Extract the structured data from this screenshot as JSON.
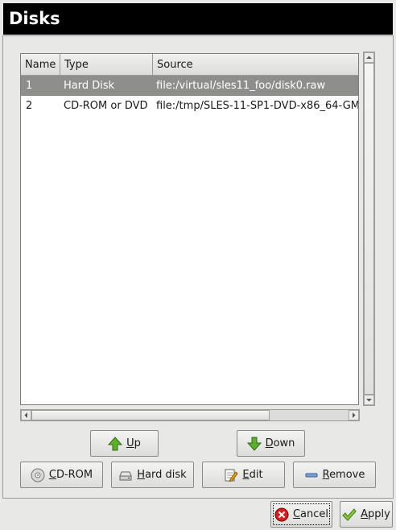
{
  "window": {
    "title": "Disks"
  },
  "table": {
    "columns": [
      "Name",
      "Type",
      "Source"
    ],
    "rows": [
      {
        "name": "1",
        "type": "Hard Disk",
        "source": "file:/virtual/sles11_foo/disk0.raw",
        "selected": true
      },
      {
        "name": "2",
        "type": "CD-ROM or DVD",
        "source": "file:/tmp/SLES-11-SP1-DVD-x86_64-GM"
      }
    ]
  },
  "buttons": {
    "up": {
      "mnemonic": "U",
      "rest": "p",
      "icon": "green-up-arrow-icon"
    },
    "down": {
      "mnemonic": "D",
      "rest": "own",
      "icon": "green-down-arrow-icon"
    },
    "cdrom": {
      "mnemonic": "C",
      "rest": "D-ROM",
      "icon": "cd-icon"
    },
    "harddisk": {
      "mnemonic": "H",
      "rest": "ard disk",
      "icon": "hard-disk-icon"
    },
    "edit": {
      "mnemonic": "E",
      "rest": "dit",
      "icon": "edit-icon"
    },
    "remove": {
      "mnemonic": "R",
      "rest": "emove",
      "icon": "minus-icon"
    },
    "cancel": {
      "mnemonic": "C",
      "rest": "ancel",
      "icon": "cancel-icon"
    },
    "apply": {
      "mnemonic": "A",
      "rest": "pply",
      "icon": "checkmark-icon"
    }
  },
  "colors": {
    "title_bg": "#000000",
    "selection_bg": "#8e8e8c",
    "arrow_green": "#5fae2e",
    "cancel_red": "#d42020"
  }
}
